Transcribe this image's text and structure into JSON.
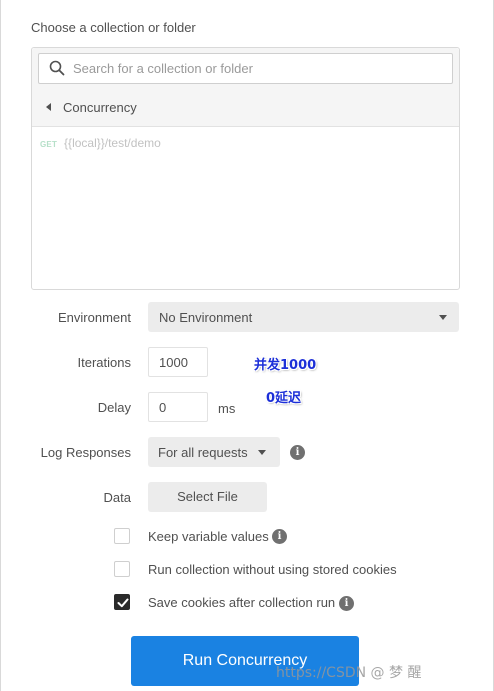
{
  "choose_label": "Choose a collection or folder",
  "search": {
    "placeholder": "Search for a collection or folder",
    "value": ""
  },
  "breadcrumb": {
    "label": "Concurrency"
  },
  "requests": [
    {
      "method": "GET",
      "url": "{{local}}/test/demo"
    }
  ],
  "form": {
    "environment_label": "Environment",
    "environment_value": "No Environment",
    "iterations_label": "Iterations",
    "iterations_value": "1000",
    "delay_label": "Delay",
    "delay_value": "0",
    "delay_unit": "ms",
    "log_label": "Log Responses",
    "log_value": "For all requests",
    "data_label": "Data",
    "select_file_label": "Select File"
  },
  "annotations": {
    "iterations_note": "并发1000",
    "delay_note": "0延迟"
  },
  "options": [
    {
      "label": "Keep variable values",
      "checked": false,
      "info": true
    },
    {
      "label": "Run collection without using stored cookies",
      "checked": false,
      "info": false
    },
    {
      "label": "Save cookies after collection run",
      "checked": true,
      "info": true
    }
  ],
  "run_button_label": "Run Concurrency",
  "watermark": "https://CSDN @ 梦 醒",
  "colors": {
    "accent": "#1a82e2",
    "method_get": "#b6e0c9",
    "annotation": "#1c2fd8"
  },
  "icons": {
    "search": "search-icon",
    "back": "caret-left-icon",
    "info": "info-icon",
    "dropdown": "chevron-down-icon",
    "check": "checkmark-icon"
  }
}
